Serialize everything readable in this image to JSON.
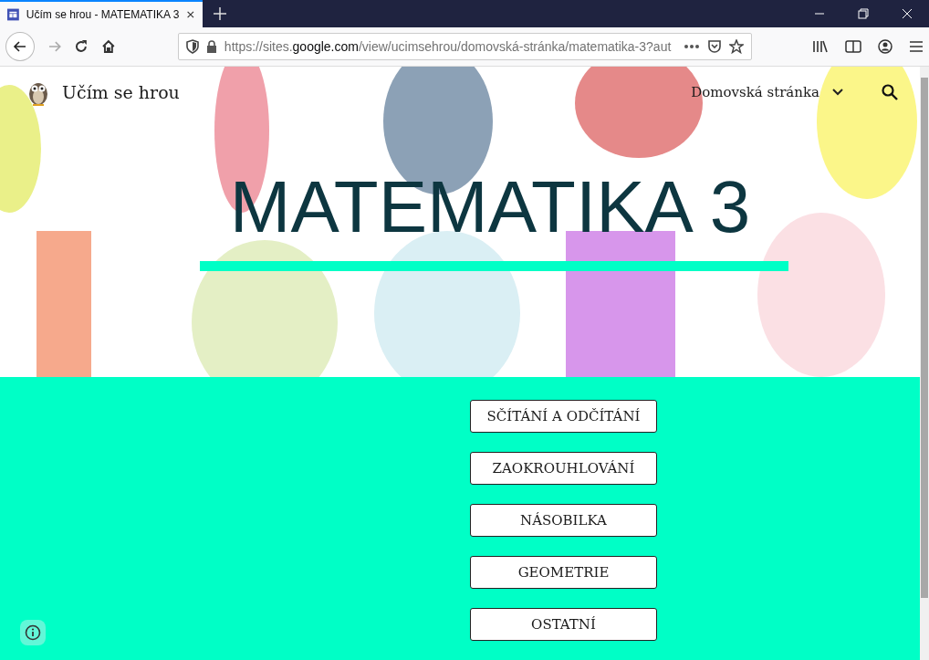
{
  "browser": {
    "tab_title": "Učím se hrou - MATEMATIKA 3",
    "url": "https://sites.**google.com**/view/ucimsehrou/domovská-stránka/matematika-3?aut"
  },
  "site": {
    "title": "Učím se hrou",
    "nav_item": "Domovská stránka"
  },
  "hero": {
    "title": "MATEMATIKA 3"
  },
  "buttons": [
    {
      "label": "SČÍTÁNÍ A ODČÍTÁNÍ"
    },
    {
      "label": "ZAOKROUHLOVÁNÍ"
    },
    {
      "label": "NÁSOBILKA"
    },
    {
      "label": "GEOMETRIE"
    },
    {
      "label": "OSTATNÍ"
    }
  ]
}
